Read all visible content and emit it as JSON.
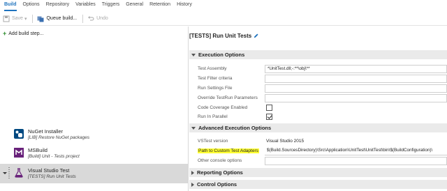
{
  "tabs": [
    {
      "label": "Build"
    },
    {
      "label": "Options"
    },
    {
      "label": "Repository"
    },
    {
      "label": "Variables"
    },
    {
      "label": "Triggers"
    },
    {
      "label": "General"
    },
    {
      "label": "Retention"
    },
    {
      "label": "History"
    }
  ],
  "toolbar": {
    "save_label": "Save",
    "queue_label": "Queue build...",
    "undo_label": "Undo"
  },
  "left_panel": {
    "add_step_label": "Add build step...",
    "steps": [
      {
        "name": "NuGet Installer",
        "subtitle": "[LIB] Restore NuGet packages",
        "icon": "nuget-icon"
      },
      {
        "name": "MSBuild",
        "subtitle": "[Build] Unit - Tests project",
        "icon": "msbuild-icon"
      },
      {
        "name": "Visual Studio Test",
        "subtitle": "[TESTS] Run Unit Tests",
        "icon": "flask-icon"
      }
    ]
  },
  "right_panel": {
    "title": "[TESTS] Run Unit Tests",
    "execution": {
      "header": "Execution Options",
      "test_assembly_label": "Test Assembly",
      "test_assembly_value": "*UnitTest.dll;-:**\\obj\\**",
      "test_filter_label": "Test Filter criteria",
      "test_filter_value": "",
      "run_settings_label": "Run Settings File",
      "run_settings_value": "",
      "override_label": "Override TestRun Parameters",
      "override_value": "",
      "coverage_label": "Code Coverage Enabled",
      "coverage_checked": false,
      "parallel_label": "Run In Parallel",
      "parallel_checked": true
    },
    "advanced": {
      "header": "Advanced Execution Options",
      "vstest_label": "VSTest version",
      "vstest_value": "Visual Studio 2015",
      "adapters_label": "Path to Custom Test Adapters",
      "adapters_value": "$(Build.SourcesDirectory)\\Src\\Application\\UnitTest\\UnitTest\\bin\\$(BuildConfiguration)\\",
      "console_label": "Other console options",
      "console_value": ""
    },
    "reporting_header": "Reporting Options",
    "control_header": "Control Options"
  },
  "colors": {
    "accent": "#1e73be",
    "highlight": "#ffff33",
    "selected_row": "#d9d9d9",
    "section_header": "#eaeaea"
  }
}
